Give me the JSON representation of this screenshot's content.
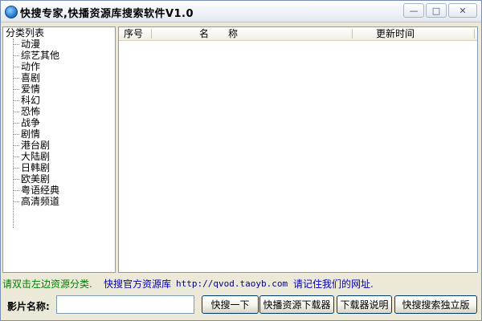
{
  "window": {
    "title": "快搜专家,快播资源库搜索软件V1.0",
    "icon": "app-globe-icon",
    "controls": {
      "minimize": "—",
      "maximize": "□",
      "close": "✕"
    }
  },
  "tree": {
    "root": "分类列表",
    "items": [
      {
        "label": "动漫"
      },
      {
        "label": "综艺其他"
      },
      {
        "label": "动作"
      },
      {
        "label": "喜剧"
      },
      {
        "label": "爱情"
      },
      {
        "label": "科幻"
      },
      {
        "label": "恐怖"
      },
      {
        "label": "战争"
      },
      {
        "label": "剧情"
      },
      {
        "label": "港台剧"
      },
      {
        "label": "大陆剧"
      },
      {
        "label": "日韩剧"
      },
      {
        "label": "欧美剧"
      },
      {
        "label": "粤语经典"
      },
      {
        "label": "高清频道"
      }
    ]
  },
  "list": {
    "columns": [
      "序号",
      "名　　称",
      "更新时间"
    ],
    "rows": []
  },
  "info": {
    "hint": "请双击左边资源分类.",
    "official_link": "快搜官方资源库",
    "url": "http://qvod.taoyb.com",
    "remember": "请记住我们的网址."
  },
  "search": {
    "label": "影片名称:",
    "value": "",
    "placeholder": ""
  },
  "buttons": {
    "search": "快搜一下",
    "downloader": "快播资源下载器",
    "download_help": "下载器说明",
    "standalone": "快搜搜索独立版"
  },
  "colors": {
    "hint_green": "#008000",
    "link_blue": "#0000c0",
    "url_navy": "#000080"
  }
}
